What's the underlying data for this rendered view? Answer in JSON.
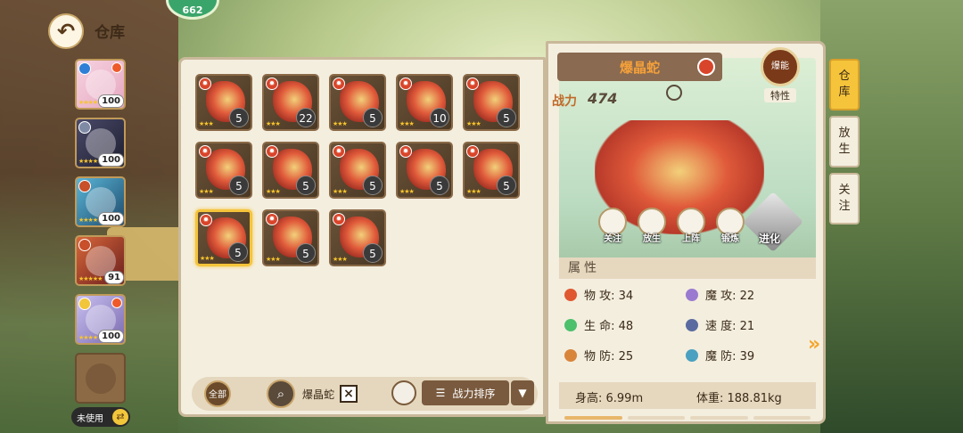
{
  "header": {
    "title": "仓库",
    "badge": "662"
  },
  "team": {
    "slots": [
      {
        "level": "100"
      },
      {
        "level": "100"
      },
      {
        "level": "100"
      },
      {
        "level": "91"
      },
      {
        "level": "100"
      }
    ],
    "unused_label": "未使用"
  },
  "storage": {
    "items": [
      {
        "count": "5"
      },
      {
        "count": "22"
      },
      {
        "count": "5"
      },
      {
        "count": "10"
      },
      {
        "count": "5"
      },
      {
        "count": "5"
      },
      {
        "count": "5"
      },
      {
        "count": "5"
      },
      {
        "count": "5"
      },
      {
        "count": "5"
      },
      {
        "count": "5"
      },
      {
        "count": "5"
      },
      {
        "count": "5"
      }
    ]
  },
  "toolbar": {
    "filter_label": "全部",
    "search_text": "爆晶蛇",
    "sort_label": "战力排序"
  },
  "detail": {
    "name": "爆晶蛇",
    "power_label": "战力",
    "power": "474",
    "trait_icon_label": "爆能",
    "trait_label": "特性",
    "actions": [
      "关注",
      "放生",
      "上阵",
      "锻炼"
    ],
    "evolve_label": "进化",
    "attributes_title": "属性",
    "attributes": [
      {
        "label": "物 攻: 34",
        "color": "#e0582f"
      },
      {
        "label": "魔 攻: 22",
        "color": "#9a7ad0"
      },
      {
        "label": "生 命: 48",
        "color": "#4cc06a"
      },
      {
        "label": "速 度: 21",
        "color": "#5a6aa0"
      },
      {
        "label": "物 防: 25",
        "color": "#d8853a"
      },
      {
        "label": "魔 防: 39",
        "color": "#4aa0c0"
      }
    ],
    "height": "身高: 6.99m",
    "weight": "体重: 188.81kg"
  },
  "side_tabs": [
    "仓库",
    "放生",
    "关注"
  ]
}
